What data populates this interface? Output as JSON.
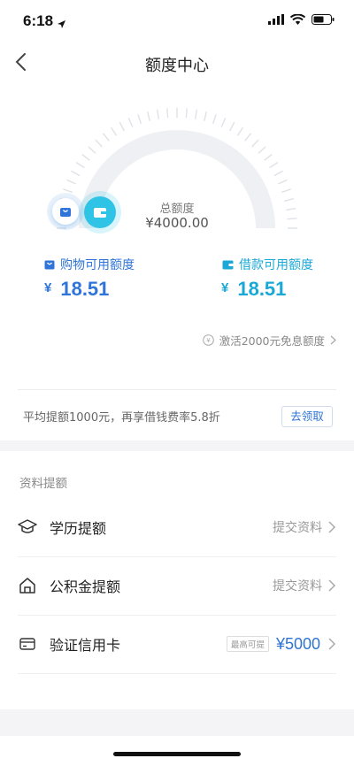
{
  "status": {
    "time": "6:18"
  },
  "nav": {
    "title": "额度中心"
  },
  "gauge": {
    "label": "总额度",
    "value": "¥4000.00"
  },
  "shopping": {
    "label": "购物可用额度",
    "currency": "¥",
    "amount": "18.51"
  },
  "loan": {
    "label": "借款可用额度",
    "currency": "¥",
    "amount": "18.51"
  },
  "activate": {
    "text": "激活2000元免息额度"
  },
  "promo": {
    "text": "平均提额1000元，再享借钱费率5.8折",
    "button": "去领取"
  },
  "section": {
    "title": "资料提额"
  },
  "items": [
    {
      "label": "学历提额",
      "action": "提交资料",
      "icon": "graduation-cap-icon"
    },
    {
      "label": "公积金提额",
      "action": "提交资料",
      "icon": "house-icon"
    },
    {
      "label": "验证信用卡",
      "tag": "最高可提",
      "amount": "¥5000",
      "icon": "credit-card-icon"
    }
  ],
  "colors": {
    "primary": "#2f74d8",
    "accent": "#1aa8d6",
    "gauge": "#eef0f3"
  }
}
